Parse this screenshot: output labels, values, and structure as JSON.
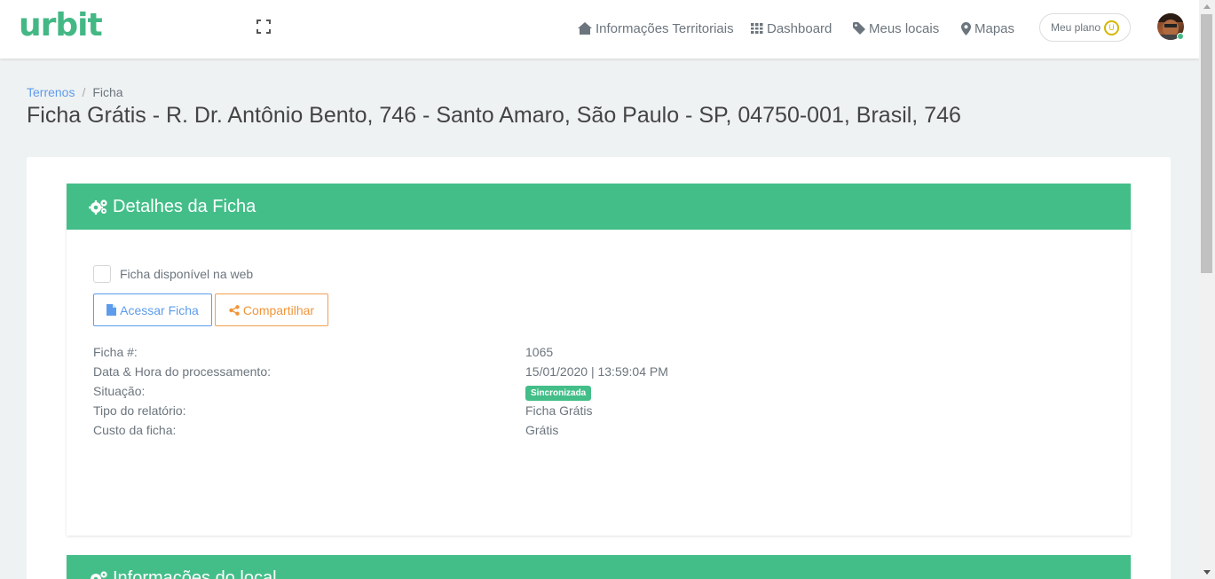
{
  "app": {
    "logo_text": "urbit",
    "brand_color": "#43b885"
  },
  "nav": {
    "items": [
      {
        "label": "Informações Territoriais",
        "icon": "home-icon"
      },
      {
        "label": "Dashboard",
        "icon": "grid-icon"
      },
      {
        "label": "Meus locais",
        "icon": "tag-icon"
      },
      {
        "label": "Mapas",
        "icon": "map-marker-icon"
      }
    ],
    "plan_label": "Meu plano",
    "plan_badge": "U"
  },
  "breadcrumb": {
    "parent": "Terrenos",
    "separator": "/",
    "current": "Ficha"
  },
  "page_title": "Ficha Grátis - R. Dr. Antônio Bento, 746 - Santo Amaro, São Paulo - SP, 04750-001, Brasil, 746",
  "panel_details": {
    "header": "Detalhes da Ficha",
    "header_icon": "gears-icon",
    "checkbox_label": "Ficha disponível na web",
    "access_button": "Acessar Ficha",
    "share_button": "Compartilhar",
    "rows": [
      {
        "label": "Ficha #:",
        "value": "1065"
      },
      {
        "label": "Data & Hora do processamento:",
        "value": "15/01/2020 | 13:59:04 PM"
      },
      {
        "label": "Situação:",
        "value": "Sincronizada"
      },
      {
        "label": "Tipo do relatório:",
        "value": "Ficha Grátis"
      },
      {
        "label": "Custo da ficha:",
        "value": "Grátis"
      }
    ]
  },
  "panel_location": {
    "header": "Informações do local",
    "header_icon": "gears-icon"
  },
  "colors": {
    "header_green": "#43be89",
    "link_blue": "#5d9cec",
    "share_orange": "#f0953a"
  }
}
